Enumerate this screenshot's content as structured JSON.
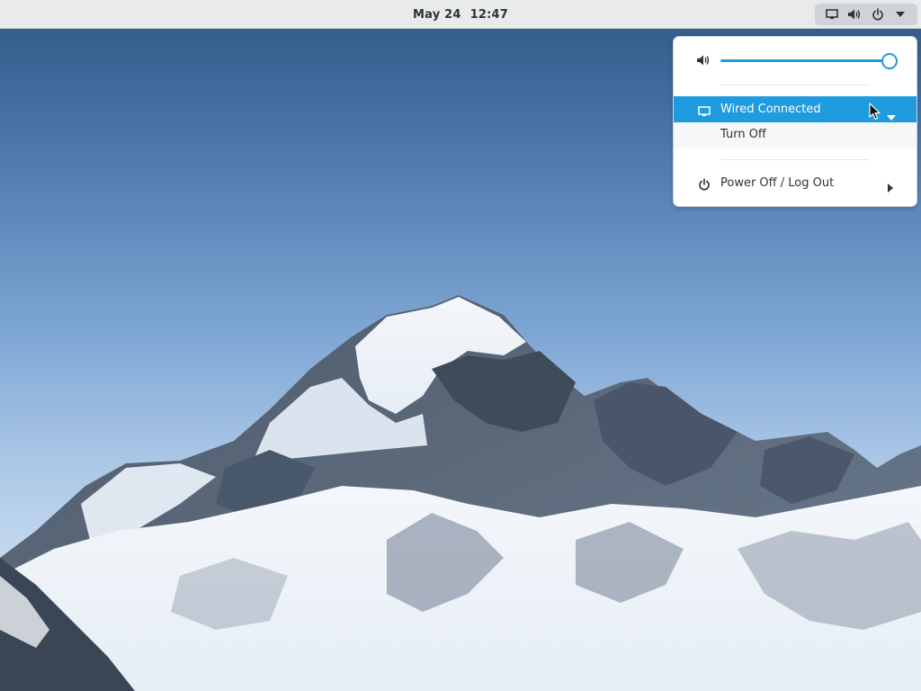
{
  "topbar": {
    "date": "May 24",
    "time": "12:47",
    "indicators": [
      "display-icon",
      "speaker-icon",
      "power-icon",
      "dropdown-caret-icon"
    ]
  },
  "system_menu": {
    "volume": {
      "icon": "speaker-icon",
      "level": 1.0
    },
    "network": {
      "icon": "display-icon",
      "label": "Wired Connected",
      "expanded": true,
      "submenu": [
        {
          "label": "Turn Off"
        }
      ]
    },
    "power": {
      "icon": "power-icon",
      "label": "Power Off / Log Out"
    }
  },
  "colors": {
    "accent": "#1f9bdf",
    "topbar_bg": "#e9eaec",
    "menu_bg": "#ffffff",
    "text": "#2e3436"
  }
}
